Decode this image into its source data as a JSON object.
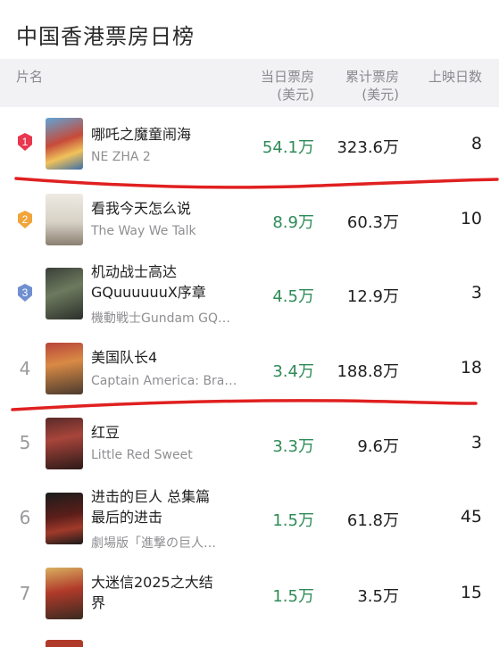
{
  "page": {
    "title": "中国香港票房日榜"
  },
  "columns": {
    "name": "片名",
    "today_line1": "当日票房",
    "today_line2": "(美元)",
    "total_line1": "累计票房",
    "total_line2": "(美元)",
    "days": "上映日数"
  },
  "rows": [
    {
      "rank": "1",
      "title_cn": "哪吒之魔童闹海",
      "title_cn_2": "",
      "title_en": "NE ZHA 2",
      "today": "54.1万",
      "total": "323.6万",
      "days": "8",
      "medal_color": "#e8374e"
    },
    {
      "rank": "2",
      "title_cn": "看我今天怎么说",
      "title_cn_2": "",
      "title_en": "The Way We Talk",
      "today": "8.9万",
      "total": "60.3万",
      "days": "10",
      "medal_color": "#f0a43a"
    },
    {
      "rank": "3",
      "title_cn": "机动战士高达",
      "title_cn_2": "GQuuuuuuX序章",
      "title_en": "機動戦士Gundam GQ…",
      "today": "4.5万",
      "total": "12.9万",
      "days": "3",
      "medal_color": "#6f8fd0"
    },
    {
      "rank": "4",
      "title_cn": "美国队长4",
      "title_cn_2": "",
      "title_en": "Captain America: Bra…",
      "today": "3.4万",
      "total": "188.8万",
      "days": "18"
    },
    {
      "rank": "5",
      "title_cn": "红豆",
      "title_cn_2": "",
      "title_en": "Little Red Sweet",
      "today": "3.3万",
      "total": "9.6万",
      "days": "3"
    },
    {
      "rank": "6",
      "title_cn": "进击的巨人 总集篇",
      "title_cn_2": "最后的进击",
      "title_en": "劇場版「進撃の巨人…",
      "today": "1.5万",
      "total": "61.8万",
      "days": "45"
    },
    {
      "rank": "7",
      "title_cn": "大迷信2025之大结",
      "title_cn_2": "界",
      "title_en": "",
      "today": "1.5万",
      "total": "3.5万",
      "days": "15"
    }
  ],
  "colors": {
    "today_green": "#2e8b57",
    "annotation_red": "#e02020"
  }
}
